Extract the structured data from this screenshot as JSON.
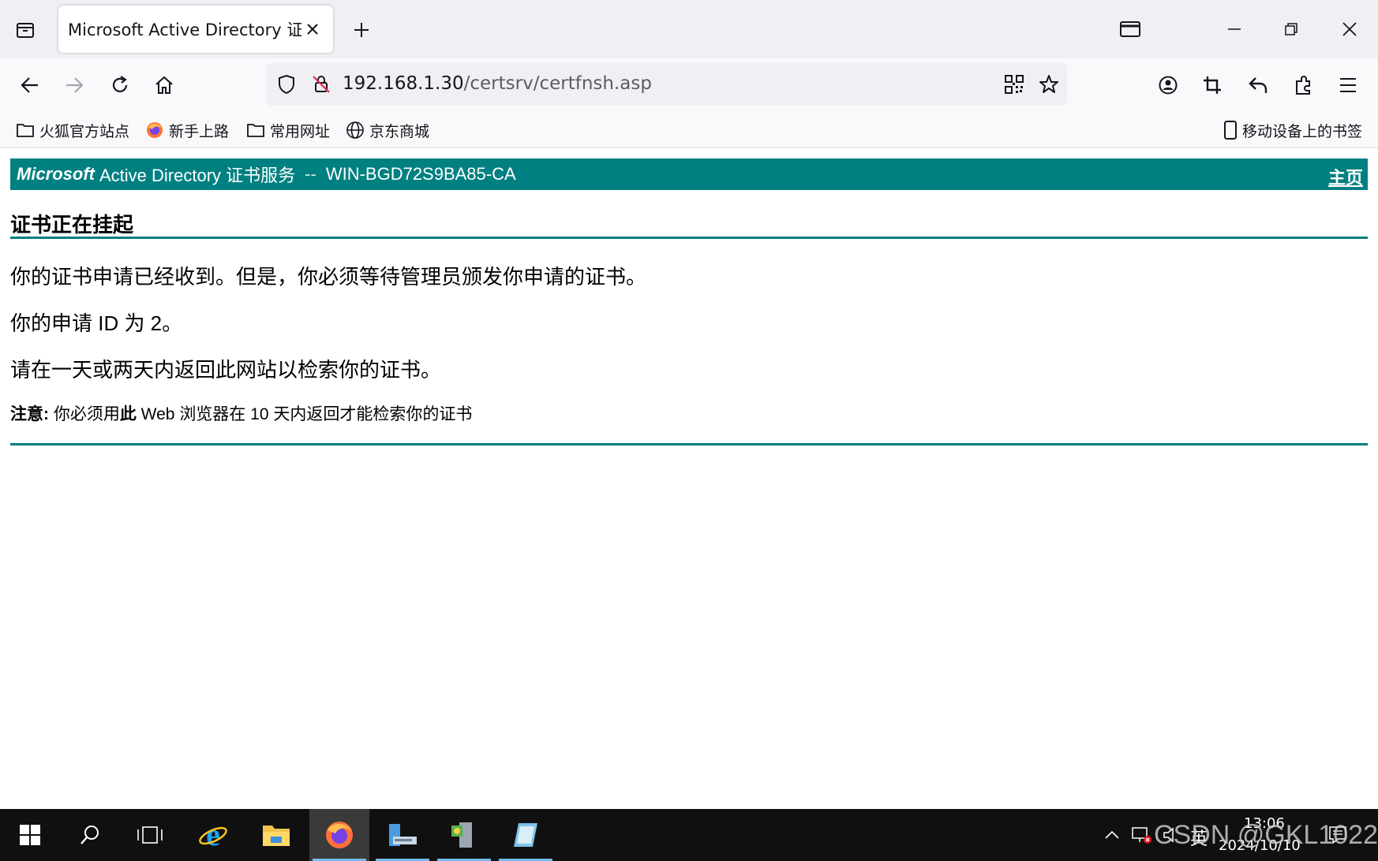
{
  "browser": {
    "tab_title": "Microsoft Active Directory 证书服",
    "url_host": "192.168.1.30",
    "url_path": "/certsrv/certfnsh.asp"
  },
  "bookmarks": {
    "items": [
      {
        "label": "火狐官方站点",
        "icon": "folder-icon"
      },
      {
        "label": "新手上路",
        "icon": "firefox-icon"
      },
      {
        "label": "常用网址",
        "icon": "folder-icon"
      },
      {
        "label": "京东商城",
        "icon": "globe-icon"
      }
    ],
    "mobile_label": "移动设备上的书签"
  },
  "page": {
    "header": {
      "brand": "Microsoft",
      "service": "Active Directory 证书服务",
      "separator": "--",
      "ca_name": "WIN-BGD72S9BA85-CA",
      "home_link": "主页"
    },
    "title": "证书正在挂起",
    "paragraphs": [
      "你的证书申请已经收到。但是，你必须等待管理员颁发你申请的证书。",
      "你的申请 ID 为 2。",
      "请在一天或两天内返回此网站以检索你的证书。"
    ],
    "note": {
      "label": "注意:",
      "text_before": " 你必须用",
      "emphasis": "此",
      "text_after": " Web 浏览器在 10 天内返回才能检索你的证书"
    }
  },
  "taskbar": {
    "time": "13:06",
    "date": "2024/10/10",
    "ime": "英",
    "watermark": "CSDN @GKL1022"
  },
  "colors": {
    "accent": "#008080",
    "taskbar": "#101010"
  }
}
